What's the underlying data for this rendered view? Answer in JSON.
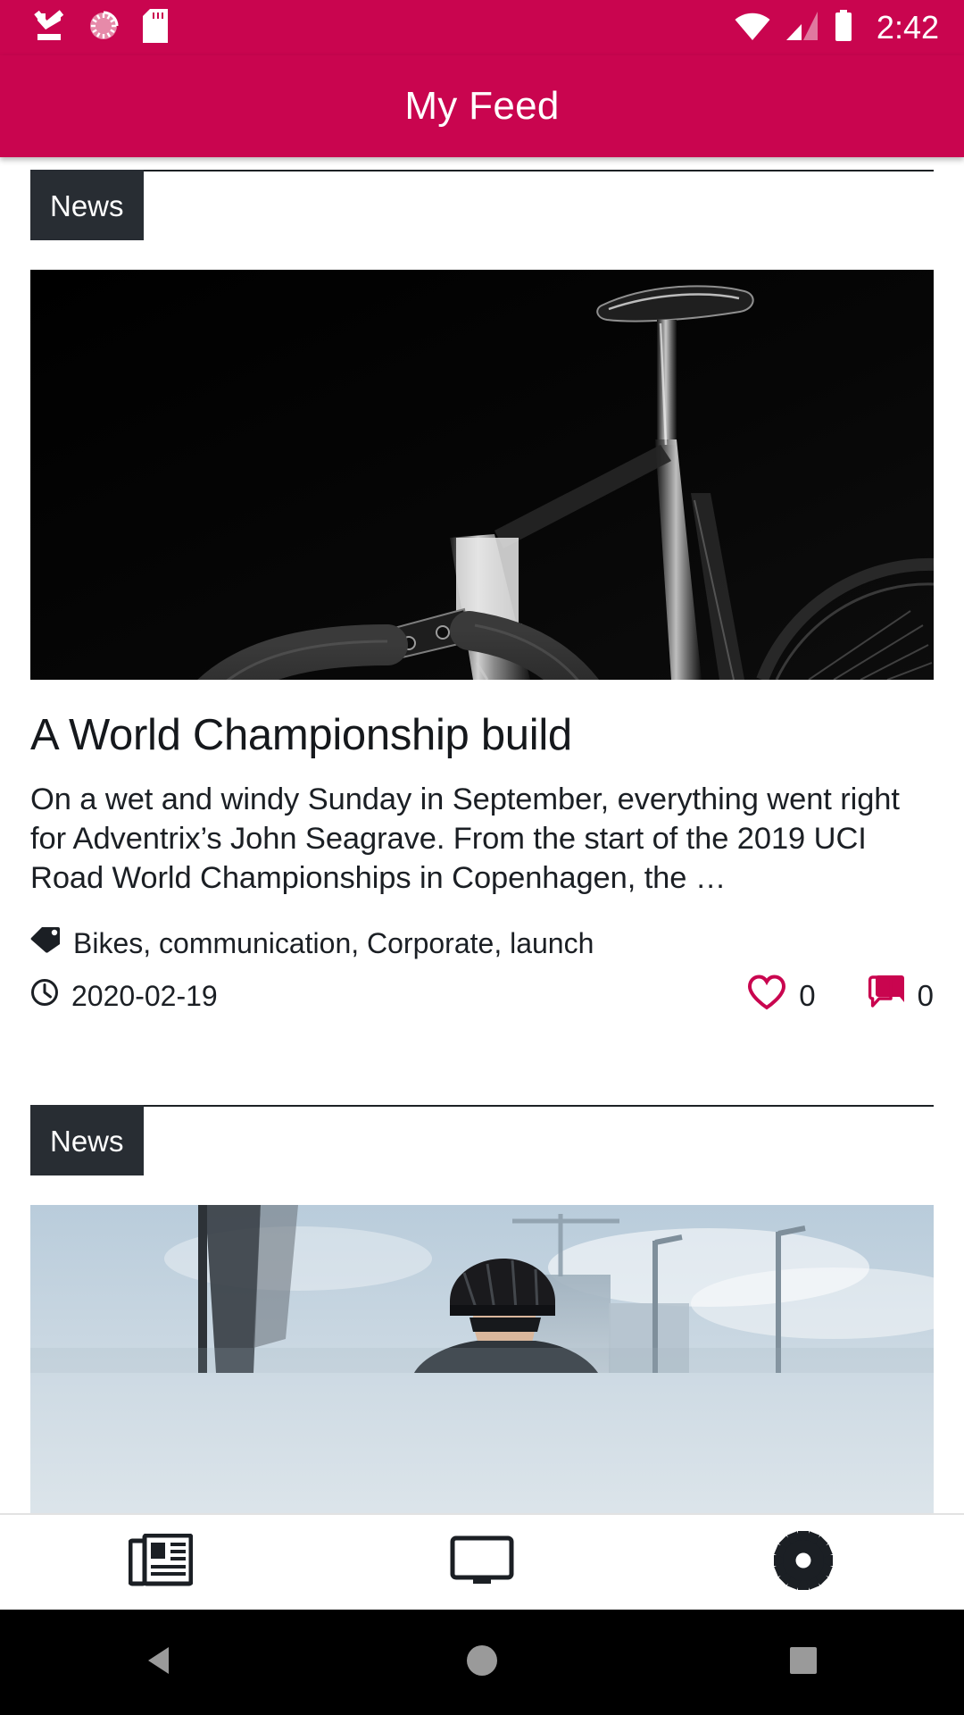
{
  "status_bar": {
    "icons": [
      "download-complete-icon",
      "sync-progress-icon",
      "sd-card-icon",
      "wifi-icon",
      "cellular-signal-icon",
      "battery-icon"
    ],
    "time": "2:42"
  },
  "app_bar": {
    "title": "My Feed",
    "color": "#c9054f"
  },
  "theme": {
    "primary": "#c9054f",
    "badge_bg": "#282d33",
    "text": "#1b1f24",
    "accent": "#c9054f"
  },
  "bottom_nav": {
    "items": [
      {
        "name": "news",
        "icon": "newspaper-icon"
      },
      {
        "name": "media",
        "icon": "monitor-icon"
      },
      {
        "name": "settings",
        "icon": "gear-icon"
      }
    ]
  },
  "system_nav": {
    "items": [
      {
        "name": "back",
        "icon": "back-triangle-icon"
      },
      {
        "name": "home",
        "icon": "home-circle-icon"
      },
      {
        "name": "recents",
        "icon": "recents-square-icon"
      }
    ]
  },
  "feed": {
    "cards": [
      {
        "category": "News",
        "image_alt": "black-and-white road bicycle handlebars",
        "title": "A World Championship build",
        "excerpt": "On a wet and windy Sunday in September, everything went right for Adventrix’s John Seagrave. From the start of the 2019 UCI Road World Championships in Copenhagen, the …",
        "tags": "Bikes, communication, Corporate, launch",
        "date": "2020-02-19",
        "likes": "0",
        "comments": "0"
      },
      {
        "category": "News",
        "image_alt": "cyclist wearing helmet outdoors with city skyline"
      }
    ]
  }
}
